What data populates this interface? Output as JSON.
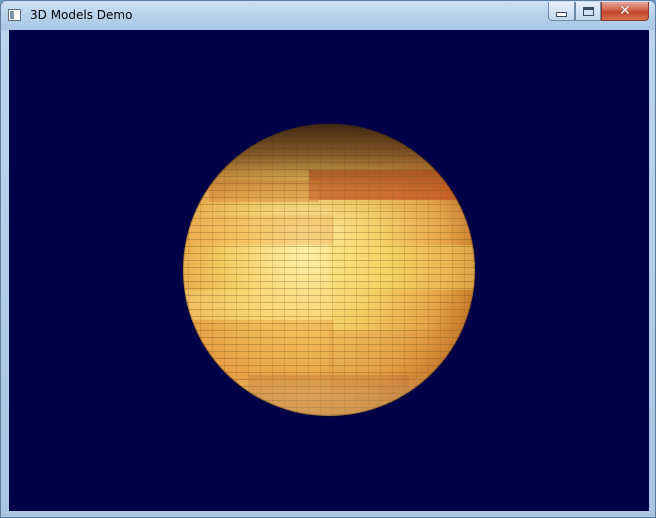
{
  "window": {
    "title": "3D Models Demo",
    "controls": {
      "minimize": "minimize",
      "maximize": "maximize",
      "close": "✕"
    }
  },
  "viewport": {
    "background_color": "#000048",
    "model": {
      "type": "textured sphere",
      "base_color": "#f2c35a",
      "highlight_color": "#fbe8a0",
      "band_color": "#b8401a",
      "shadow_color": "#3a2310"
    }
  }
}
